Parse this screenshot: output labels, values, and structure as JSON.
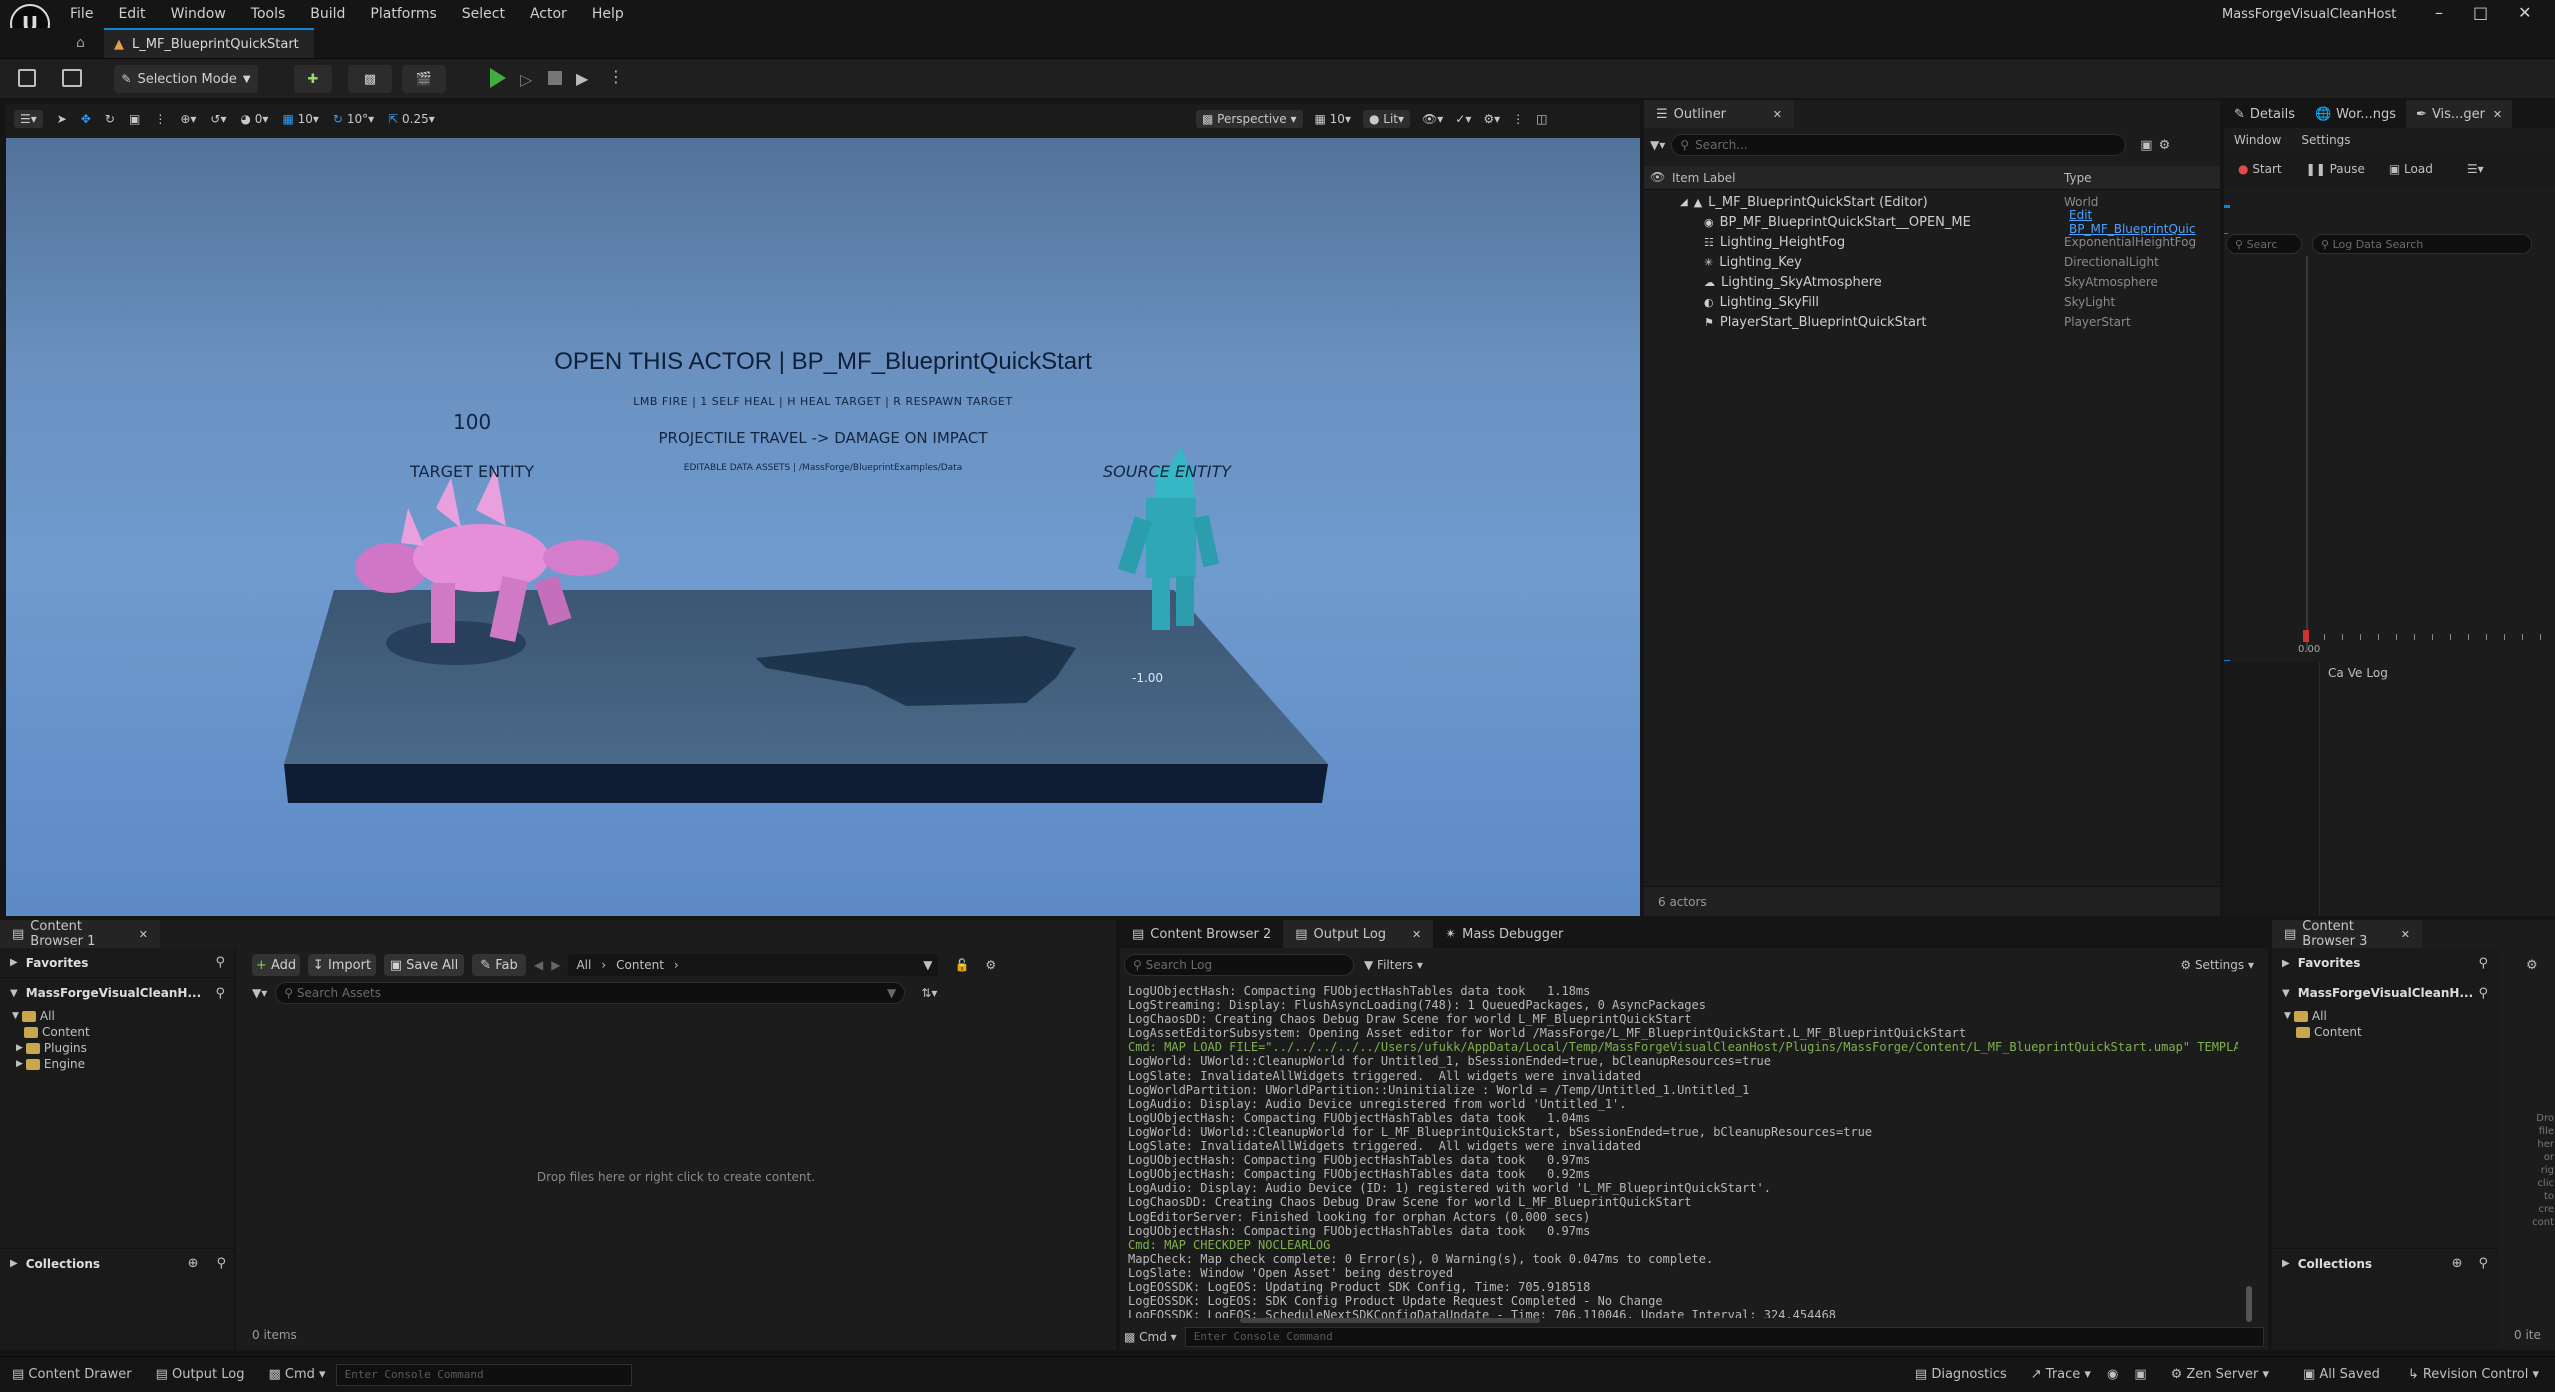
{
  "app": {
    "title": "MassForgeVisualCleanHost",
    "tab": "L_MF_BlueprintQuickStart",
    "menu": [
      "File",
      "Edit",
      "Window",
      "Tools",
      "Build",
      "Platforms",
      "Select",
      "Actor",
      "Help"
    ]
  },
  "toolbar": {
    "selection_mode": "Selection Mode"
  },
  "viewport_toolbar": {
    "rot_snap": "0",
    "grid_snap": "10",
    "angle_snap": "10°",
    "scale_snap": "0.25",
    "perspective": "Perspective",
    "speed": "10",
    "view_mode": "Lit"
  },
  "scene": {
    "headline": "OPEN THIS ACTOR  |  BP_MF_BlueprintQuickStart",
    "controls": "LMB  FIRE   |   1  SELF HEAL   |   H  HEAL TARGET   |   R  RESPAWN TARGET",
    "projectile": "PROJECTILE TRAVEL  ->  DAMAGE ON IMPACT",
    "assets": "EDITABLE DATA ASSETS  |  /MassForge/BlueprintExamples/Data",
    "target_health": "100",
    "target_label": "TARGET ENTITY",
    "source_label": "SOURCE ENTITY",
    "source_value": "-1.00"
  },
  "outliner": {
    "tab": "Outliner",
    "search_placeholder": "Search...",
    "col_label": "Item Label",
    "col_type": "Type",
    "rows": [
      {
        "label": "L_MF_BlueprintQuickStart (Editor)",
        "type": "World"
      },
      {
        "label": "BP_MF_BlueprintQuickStart__OPEN_ME",
        "type": "Edit BP_MF_BlueprintQuic"
      },
      {
        "label": "Lighting_HeightFog",
        "type": "ExponentialHeightFog"
      },
      {
        "label": "Lighting_Key",
        "type": "DirectionalLight"
      },
      {
        "label": "Lighting_SkyAtmosphere",
        "type": "SkyAtmosphere"
      },
      {
        "label": "Lighting_SkyFill",
        "type": "SkyLight"
      },
      {
        "label": "PlayerStart_BlueprintQuickStart",
        "type": "PlayerStart"
      }
    ],
    "footer": "6 actors"
  },
  "right_panel": {
    "tabs": [
      "Details",
      "Wor...ngs",
      "Vis...ger"
    ],
    "menu": [
      "Window",
      "Settings"
    ],
    "start": "Start",
    "pause": "Pause",
    "load": "Load",
    "search_placeholder": "Searc",
    "log_search_placeholder": "Log Data Search",
    "time": "0.00",
    "subtabs": [
      "Ca",
      "Ve",
      "Log"
    ]
  },
  "content_browser_1": {
    "tab": "Content Browser 1",
    "favorites": "Favorites",
    "project": "MassForgeVisualCleanH...",
    "tree": [
      "All",
      "Content",
      "Plugins",
      "Engine"
    ],
    "add": "Add",
    "import": "Import",
    "save_all": "Save All",
    "fab": "Fab",
    "path": [
      "All",
      "Content"
    ],
    "search_placeholder": "Search Assets",
    "empty": "Drop files here or right click to create content.",
    "collections": "Collections",
    "items": "0 items"
  },
  "output_log": {
    "tabs": [
      "Content Browser 2",
      "Output Log",
      "Mass Debugger"
    ],
    "search_placeholder": "Search Log",
    "filters": "Filters",
    "settings": "Settings",
    "lines": [
      {
        "t": "LogUObjectHash: Compacting FUObjectHashTables data took   1.18ms",
        "c": false
      },
      {
        "t": "LogStreaming: Display: FlushAsyncLoading(748): 1 QueuedPackages, 0 AsyncPackages",
        "c": false
      },
      {
        "t": "LogChaosDD: Creating Chaos Debug Draw Scene for world L_MF_BlueprintQuickStart",
        "c": false
      },
      {
        "t": "LogAssetEditorSubsystem: Opening Asset editor for World /MassForge/L_MF_BlueprintQuickStart.L_MF_BlueprintQuickStart",
        "c": false
      },
      {
        "t": "Cmd: MAP LOAD FILE=\"../../../../../Users/ufukk/AppData/Local/Temp/MassForgeVisualCleanHost/Plugins/MassForge/Content/L_MF_BlueprintQuickStart.umap\" TEMPLATE",
        "c": true
      },
      {
        "t": "LogWorld: UWorld::CleanupWorld for Untitled_1, bSessionEnded=true, bCleanupResources=true",
        "c": false
      },
      {
        "t": "LogSlate: InvalidateAllWidgets triggered.  All widgets were invalidated",
        "c": false
      },
      {
        "t": "LogWorldPartition: UWorldPartition::Uninitialize : World = /Temp/Untitled_1.Untitled_1",
        "c": false
      },
      {
        "t": "LogAudio: Display: Audio Device unregistered from world 'Untitled_1'.",
        "c": false
      },
      {
        "t": "LogUObjectHash: Compacting FUObjectHashTables data took   1.04ms",
        "c": false
      },
      {
        "t": "LogWorld: UWorld::CleanupWorld for L_MF_BlueprintQuickStart, bSessionEnded=true, bCleanupResources=true",
        "c": false
      },
      {
        "t": "LogSlate: InvalidateAllWidgets triggered.  All widgets were invalidated",
        "c": false
      },
      {
        "t": "LogUObjectHash: Compacting FUObjectHashTables data took   0.97ms",
        "c": false
      },
      {
        "t": "LogUObjectHash: Compacting FUObjectHashTables data took   0.92ms",
        "c": false
      },
      {
        "t": "LogAudio: Display: Audio Device (ID: 1) registered with world 'L_MF_BlueprintQuickStart'.",
        "c": false
      },
      {
        "t": "LogChaosDD: Creating Chaos Debug Draw Scene for world L_MF_BlueprintQuickStart",
        "c": false
      },
      {
        "t": "LogEditorServer: Finished looking for orphan Actors (0.000 secs)",
        "c": false
      },
      {
        "t": "LogUObjectHash: Compacting FUObjectHashTables data took   0.97ms",
        "c": false
      },
      {
        "t": "Cmd: MAP CHECKDEP NOCLEARLOG",
        "c": true
      },
      {
        "t": "MapCheck: Map check complete: 0 Error(s), 0 Warning(s), took 0.047ms to complete.",
        "c": false
      },
      {
        "t": "LogSlate: Window 'Open Asset' being destroyed",
        "c": false
      },
      {
        "t": "LogEOSSDK: LogEOS: Updating Product SDK Config, Time: 705.918518",
        "c": false
      },
      {
        "t": "LogEOSSDK: LogEOS: SDK Config Product Update Request Completed - No Change",
        "c": false
      },
      {
        "t": "LogEOSSDK: LogEOS: ScheduleNextSDKConfigDataUpdate - Time: 706.110046, Update Interval: 324.454468",
        "c": false
      }
    ],
    "cmd": "Cmd",
    "cmd_placeholder": "Enter Console Command"
  },
  "content_browser_3": {
    "tab": "Content Browser 3",
    "favorites": "Favorites",
    "project": "MassForgeVisualCleanH...",
    "tree": [
      "All",
      "Content"
    ],
    "collections": "Collections",
    "items": "0 ite",
    "hint": [
      "Dro",
      "file",
      "her",
      "or",
      "rig",
      "clic",
      "to",
      "cre",
      "cont"
    ]
  },
  "statusbar": {
    "content_drawer": "Content Drawer",
    "output_log": "Output Log",
    "cmd": "Cmd",
    "cmd_placeholder": "Enter Console Command",
    "diagnostics": "Diagnostics",
    "trace": "Trace",
    "zen": "Zen Server",
    "saved": "All Saved",
    "revision": "Revision Control"
  },
  "colors": {
    "accent": "#0e86d4",
    "play": "#3fae3f",
    "target": "#e58fd8",
    "source": "#35b7c6"
  }
}
